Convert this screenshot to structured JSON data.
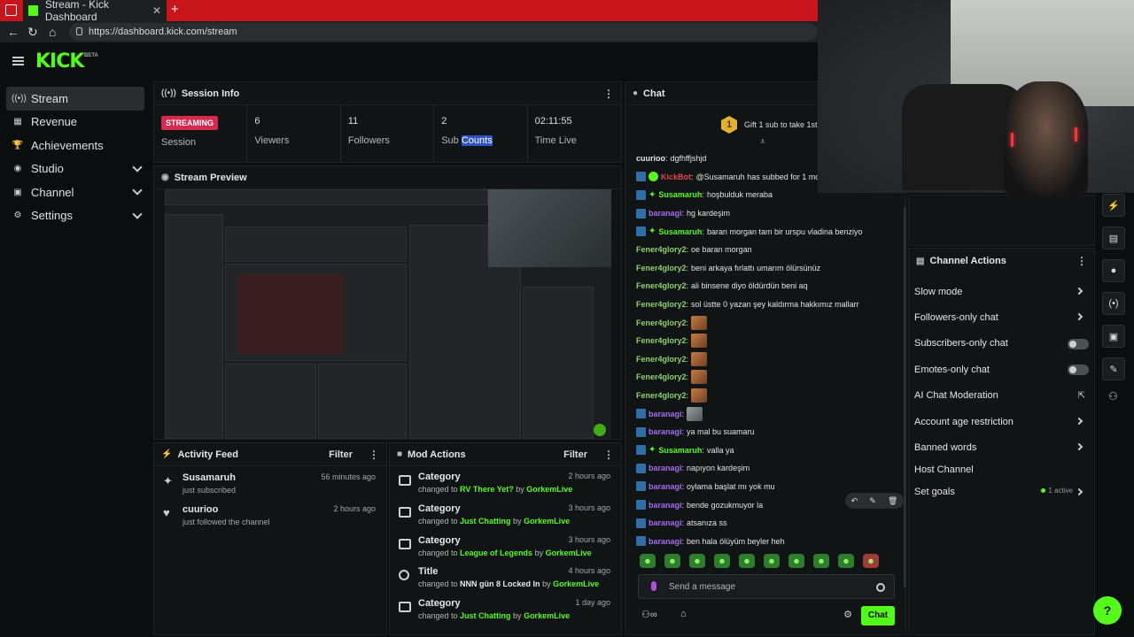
{
  "browser": {
    "tab_title": "Stream - Kick Dashboard",
    "url": "https://dashboard.kick.com/stream"
  },
  "app": {
    "logo": "KICK",
    "logo_badge": "BETA"
  },
  "sidebar": {
    "items": [
      {
        "label": "Stream",
        "icon": "broadcast-icon"
      },
      {
        "label": "Revenue",
        "icon": "revenue-icon"
      },
      {
        "label": "Achievements",
        "icon": "trophy-icon"
      },
      {
        "label": "Studio",
        "icon": "studio-icon"
      },
      {
        "label": "Channel",
        "icon": "channel-icon"
      },
      {
        "label": "Settings",
        "icon": "gear-icon"
      }
    ]
  },
  "session": {
    "title": "Session Info",
    "status_badge": "STREAMING",
    "stats": [
      {
        "value": "",
        "label": "Session"
      },
      {
        "value": "6",
        "label": "Viewers"
      },
      {
        "value": "11",
        "label": "Followers"
      },
      {
        "value": "2",
        "label_a": "Sub ",
        "label_b": "Counts"
      },
      {
        "value": "02:11:55",
        "label": "Time Live"
      }
    ]
  },
  "preview": {
    "title": "Stream Preview"
  },
  "activity": {
    "title": "Activity Feed",
    "filter": "Filter",
    "items": [
      {
        "name": "Susamaruh",
        "sub": "just subscribed",
        "time": "56 minutes ago",
        "icon": "sparkle-icon"
      },
      {
        "name": "cuurioo",
        "sub": "just followed the channel",
        "time": "2 hours ago",
        "icon": "heart-icon"
      }
    ]
  },
  "mod": {
    "title": "Mod Actions",
    "filter": "Filter",
    "items": [
      {
        "title": "Category",
        "pre": "changed to ",
        "value": "RV There Yet?",
        "by": " by ",
        "user": "GorkemLive",
        "time": "2 hours ago"
      },
      {
        "title": "Category",
        "pre": "changed to ",
        "value": "Just Chatting",
        "by": " by ",
        "user": "GorkemLive",
        "time": "3 hours ago"
      },
      {
        "title": "Category",
        "pre": "changed to ",
        "value": "League of Legends",
        "by": "  by ",
        "user": "GorkemLive",
        "time": "3 hours ago"
      },
      {
        "title": "Title",
        "pre": "changed to ",
        "value": "NNN gün 8 Locked In",
        "by": " by ",
        "user": "GorkemLive",
        "time": "4 hours ago"
      },
      {
        "title": "Category",
        "pre": "changed to ",
        "value": "Just Chatting",
        "by": " by ",
        "user": "GorkemLive",
        "time": "1 day ago"
      }
    ]
  },
  "chat": {
    "title": "Chat",
    "gift_count": "1",
    "gift_text": "Gift 1 sub to take 1st",
    "input_placeholder": "Send a message",
    "send_label": "Chat",
    "messages": [
      {
        "user": "cuurioo",
        "color": "#e4e4e4",
        "text": "dgfhffjshjd",
        "badges": []
      },
      {
        "user": "KickBot",
        "color": "#e0484d",
        "text": "@Susamaruh has subbed for 1 mo",
        "badges": [
          "mod",
          "verified"
        ]
      },
      {
        "user": "Susamaruh",
        "color": "#53fc18",
        "text": "hoşbulduk meraba",
        "badges": [
          "mod",
          "sub"
        ]
      },
      {
        "user": "baranagi",
        "color": "#a56bf0",
        "text": "hg kardeşim",
        "badges": [
          "mod"
        ]
      },
      {
        "user": "Susamaruh",
        "color": "#53fc18",
        "text": "baran morgan tam bir urspu vladina benziyo",
        "badges": [
          "mod",
          "sub"
        ]
      },
      {
        "user": "Fener4glory2",
        "color": "#8ed16a",
        "text": "oe baran morgan",
        "badges": []
      },
      {
        "user": "Fener4glory2",
        "color": "#8ed16a",
        "text": "beni arkaya fırlattı umarım ölürsünüz",
        "badges": []
      },
      {
        "user": "Fener4glory2",
        "color": "#8ed16a",
        "text": "ali binsene diyo öldürdün beni aq",
        "badges": []
      },
      {
        "user": "Fener4glory2",
        "color": "#8ed16a",
        "text": "sol üstte 0 yazan şey kaldırma hakkımız mallarr",
        "badges": []
      },
      {
        "user": "Fener4glory2",
        "color": "#8ed16a",
        "text": "",
        "emote": "brown",
        "badges": []
      },
      {
        "user": "Fener4glory2",
        "color": "#8ed16a",
        "text": "",
        "emote": "brown",
        "badges": []
      },
      {
        "user": "Fener4glory2",
        "color": "#8ed16a",
        "text": "",
        "emote": "brown",
        "badges": []
      },
      {
        "user": "Fener4glory2",
        "color": "#8ed16a",
        "text": "",
        "emote": "brown",
        "badges": []
      },
      {
        "user": "Fener4glory2",
        "color": "#8ed16a",
        "text": "",
        "emote": "brown",
        "badges": []
      },
      {
        "user": "baranagi",
        "color": "#a56bf0",
        "text": "",
        "emote": "gray",
        "badges": [
          "mod"
        ]
      },
      {
        "user": "baranagi",
        "color": "#a56bf0",
        "text": "ya mal bu suamaru",
        "badges": [
          "mod"
        ]
      },
      {
        "user": "Susamaruh",
        "color": "#53fc18",
        "text": "valla ya",
        "badges": [
          "mod",
          "sub"
        ]
      },
      {
        "user": "baranagi",
        "color": "#a56bf0",
        "text": "napıyon kardeşim",
        "badges": [
          "mod"
        ]
      },
      {
        "user": "baranagi",
        "color": "#a56bf0",
        "text": "oylama başlat mı yok mu",
        "badges": [
          "mod"
        ]
      },
      {
        "user": "baranagi",
        "color": "#a56bf0",
        "text": "bende gozukmuyor la",
        "badges": [
          "mod"
        ]
      },
      {
        "user": "baranagi",
        "color": "#a56bf0",
        "text": "atsanıza ss",
        "badges": [
          "mod"
        ]
      },
      {
        "user": "baranagi",
        "color": "#a56bf0",
        "text": "ben hala ölüyüm beyler heh",
        "badges": [
          "mod"
        ]
      }
    ]
  },
  "channel_actions": {
    "title": "Channel Actions",
    "items": [
      {
        "label": "Slow mode",
        "control": "arrow"
      },
      {
        "label": "Followers-only chat",
        "control": "arrow"
      },
      {
        "label": "Subscribers-only chat",
        "control": "toggle"
      },
      {
        "label": "Emotes-only chat",
        "control": "toggle"
      },
      {
        "label": "AI Chat Moderation",
        "control": "external"
      },
      {
        "label": "Account age restriction",
        "control": "arrow"
      },
      {
        "label": "Banned words",
        "control": "arrow"
      },
      {
        "label": "Host Channel",
        "control": "none"
      },
      {
        "label": "Set goals",
        "control": "arrow",
        "extra": "1 active"
      }
    ]
  },
  "rail": [
    "lightning-icon",
    "notes-icon",
    "chat-bubble-icon",
    "broadcast-icon",
    "store-icon",
    "wrench-icon"
  ],
  "colors": {
    "accent": "#53fc18",
    "streaming": "#d6294f",
    "tabbar": "#c8141b"
  }
}
